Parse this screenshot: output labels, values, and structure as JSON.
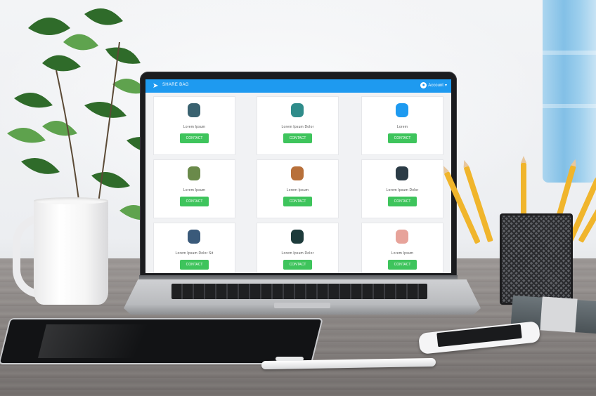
{
  "app": {
    "title": "SHARE BAG",
    "account_label": "Account",
    "colors": {
      "header": "#1e9af0",
      "button": "#3ec45c"
    }
  },
  "cards": [
    {
      "label": "Lorem Ipsum",
      "button": "CONTACT",
      "avatar_color": "#3a6270",
      "avatar": "person-icon"
    },
    {
      "label": "Lorem Ipsum Dolor",
      "button": "CONTACT",
      "avatar_color": "#2f8c8a",
      "avatar": "person-icon"
    },
    {
      "label": "Lorem",
      "button": "CONTACT",
      "avatar_color": "#1e9af0",
      "avatar": "person-icon"
    },
    {
      "label": "Lorem Ipsum",
      "button": "CONTACT",
      "avatar_color": "#6a8a4a",
      "avatar": "person-icon"
    },
    {
      "label": "Lorem Ipsum",
      "button": "CONTACT",
      "avatar_color": "#b8703a",
      "avatar": "person-icon"
    },
    {
      "label": "Lorem Ipsum Dolor",
      "button": "CONTACT",
      "avatar_color": "#2b3b46",
      "avatar": "person-icon"
    },
    {
      "label": "Lorem Ipsum Dolor Sit",
      "button": "CONTACT",
      "avatar_color": "#3a5a7a",
      "avatar": "person-icon"
    },
    {
      "label": "Lorem Ipsum Dolor",
      "button": "CONTACT",
      "avatar_color": "#1d3b3b",
      "avatar": "person-icon"
    },
    {
      "label": "Lorem Ipsum",
      "button": "CONTACT",
      "avatar_color": "#e7a39a",
      "avatar": "person-icon"
    }
  ]
}
